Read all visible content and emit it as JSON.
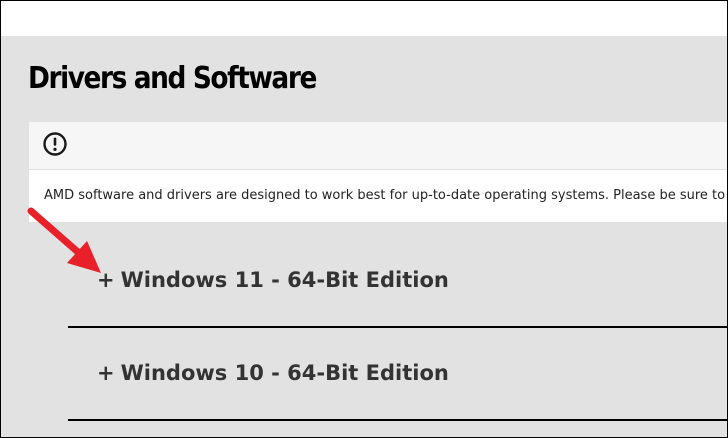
{
  "page": {
    "title": "Drivers and Software"
  },
  "notice": {
    "icon": "exclamation-circle-icon",
    "text": "AMD software and drivers are designed to work best for up-to-date operating systems. Please be sure to"
  },
  "accordion": {
    "items": [
      {
        "plus": "+",
        "label": "Windows 11 - 64-Bit Edition"
      },
      {
        "plus": "+",
        "label": "Windows 10 - 64-Bit Edition"
      }
    ]
  },
  "annotation": {
    "arrow_color": "#e8202a"
  }
}
